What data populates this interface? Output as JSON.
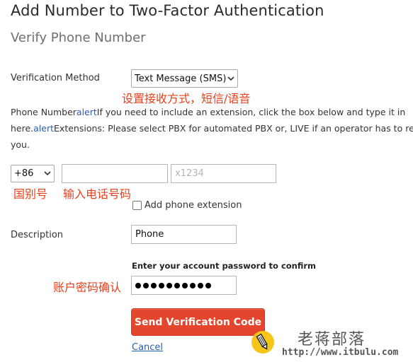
{
  "header": {
    "title": "Add Number to Two-Factor Authentication",
    "subtitle": "Verify Phone Number"
  },
  "verification": {
    "label": "Verification Method",
    "selected": "Text Message (SMS)",
    "annotation": "设置接收方式，短信/语音"
  },
  "help": {
    "line1_prefix": "Phone Number",
    "alert_link_1": "alert",
    "line1_rest": "If you need to include an extension, click the box below and type it in",
    "line2_prefix": "here.",
    "alert_link_2": "alert",
    "line2_rest": "Extensions: Please select PBX for automated PBX or, LIVE if an operator has to re",
    "line3": "you."
  },
  "phone": {
    "country_code": "+86",
    "number_value": "",
    "extension_placeholder": "x1234",
    "country_annotation": "国别号",
    "number_annotation": "输入电话号码",
    "extension_checkbox_label": "Add phone extension"
  },
  "description": {
    "label": "Description",
    "value": "Phone"
  },
  "password": {
    "label": "Enter your account password to confirm",
    "annotation": "账户密码确认",
    "masked_count": 10
  },
  "actions": {
    "send_label": "Send Verification Code",
    "cancel_label": "Cancel"
  },
  "watermark": {
    "title": "老蒋部落",
    "url": "http://www.itbulu.com"
  },
  "colors": {
    "accent_button": "#e3452d",
    "annotation": "#e8401c",
    "link": "#2a5db0"
  },
  "icons": {
    "select_arrow": "chevron-down-icon",
    "watermark_logo": "pencil-logo-icon"
  }
}
